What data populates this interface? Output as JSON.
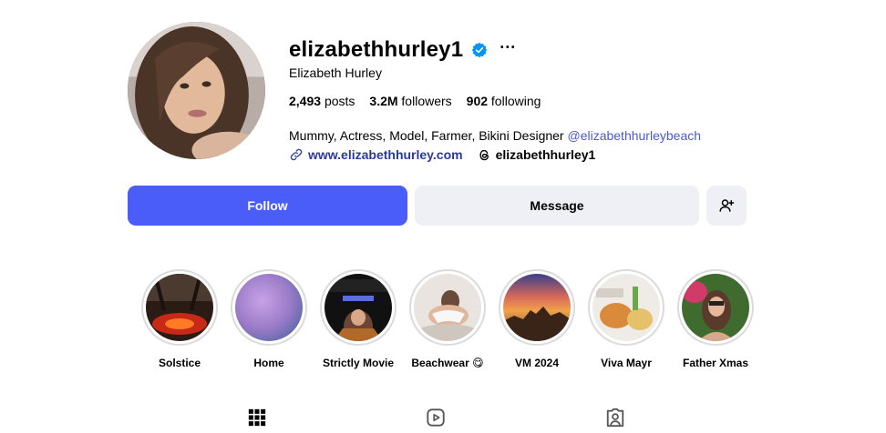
{
  "profile": {
    "username": "elizabethhurley1",
    "full_name": "Elizabeth Hurley",
    "verified": true,
    "more_label": "···",
    "stats": {
      "posts_value": "2,493",
      "posts_label": "posts",
      "followers_value": "3.2M",
      "followers_label": "followers",
      "following_value": "902",
      "following_label": "following"
    },
    "bio_text": "Mummy, Actress, Model, Farmer, Bikini Designer ",
    "bio_mention": "@elizabethhurleybeach",
    "website": "www.elizabethhurley.com",
    "threads_handle": "elizabethhurley1"
  },
  "actions": {
    "follow_label": "Follow",
    "message_label": "Message",
    "suggest_icon": "add-person-icon"
  },
  "highlights": [
    {
      "label": "Solstice"
    },
    {
      "label": "Home"
    },
    {
      "label": "Strictly Movie"
    },
    {
      "label": "Beachwear 😋"
    },
    {
      "label": "VM 2024"
    },
    {
      "label": "Viva Mayr"
    },
    {
      "label": "Father Xmas"
    }
  ],
  "tabs": [
    "grid-icon",
    "reels-icon",
    "tagged-icon"
  ],
  "colors": {
    "follow_bg": "#4a5df9",
    "secondary_bg": "#eff0f5",
    "link": "#2a3a9a",
    "mention": "#4a5bc7",
    "verified": "#0095f6"
  }
}
